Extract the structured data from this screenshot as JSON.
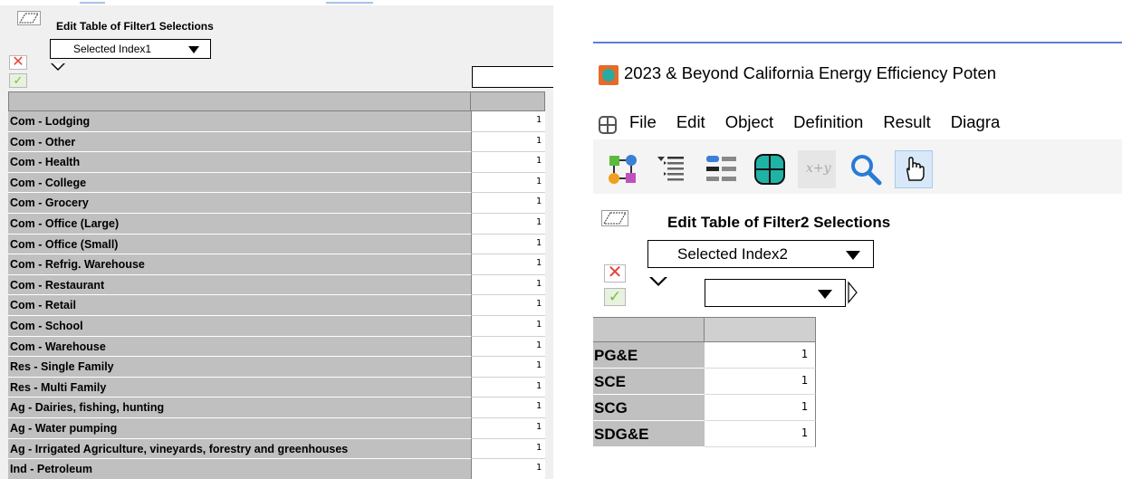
{
  "left_panel": {
    "title": "Edit Table of Filter1 Selections",
    "index_dropdown": "Selected Index1",
    "rows": [
      {
        "label": "Com - Lodging",
        "value": "1"
      },
      {
        "label": "Com - Other",
        "value": "1"
      },
      {
        "label": "Com - Health",
        "value": "1"
      },
      {
        "label": "Com - College",
        "value": "1"
      },
      {
        "label": "Com - Grocery",
        "value": "1"
      },
      {
        "label": "Com - Office (Large)",
        "value": "1"
      },
      {
        "label": "Com - Office (Small)",
        "value": "1"
      },
      {
        "label": "Com - Refrig. Warehouse",
        "value": "1"
      },
      {
        "label": "Com - Restaurant",
        "value": "1"
      },
      {
        "label": "Com - Retail",
        "value": "1"
      },
      {
        "label": "Com - School",
        "value": "1"
      },
      {
        "label": "Com - Warehouse",
        "value": "1"
      },
      {
        "label": "Res - Single Family",
        "value": "1"
      },
      {
        "label": "Res - Multi Family",
        "value": "1"
      },
      {
        "label": "Ag - Dairies, fishing, hunting",
        "value": "1"
      },
      {
        "label": "Ag - Water pumping",
        "value": "1"
      },
      {
        "label": "Ag - Irrigated Agriculture, vineyards, forestry and greenhouses",
        "value": "1"
      },
      {
        "label": "Ind - Petroleum",
        "value": "1"
      }
    ]
  },
  "right_panel": {
    "window_title": "2023 & Beyond California Energy Efficiency Poten",
    "menu": [
      "File",
      "Edit",
      "Object",
      "Definition",
      "Result",
      "Diagra"
    ],
    "toolbar_icons": [
      "diagram-icon",
      "outline-icon",
      "attribute-panel-icon",
      "edit-table-icon",
      "expression-icon",
      "search-icon",
      "browse-hand-icon"
    ],
    "toolbar_expression_label": "x+y",
    "title": "Edit Table of Filter2 Selections",
    "index_dropdown": "Selected Index2",
    "rows": [
      {
        "label": "PG&E",
        "value": "1"
      },
      {
        "label": "SCE",
        "value": "1"
      },
      {
        "label": "SCG",
        "value": "1"
      },
      {
        "label": "SDG&E",
        "value": "1"
      }
    ]
  },
  "colors": {
    "row_label_bg": "#c0c0c0",
    "panel_bg": "#f0f0f0",
    "cancel_red": "#e8403a",
    "accept_green": "#6fbf3a",
    "app_orange": "#e46b2a",
    "app_teal": "#2aa9a0"
  }
}
